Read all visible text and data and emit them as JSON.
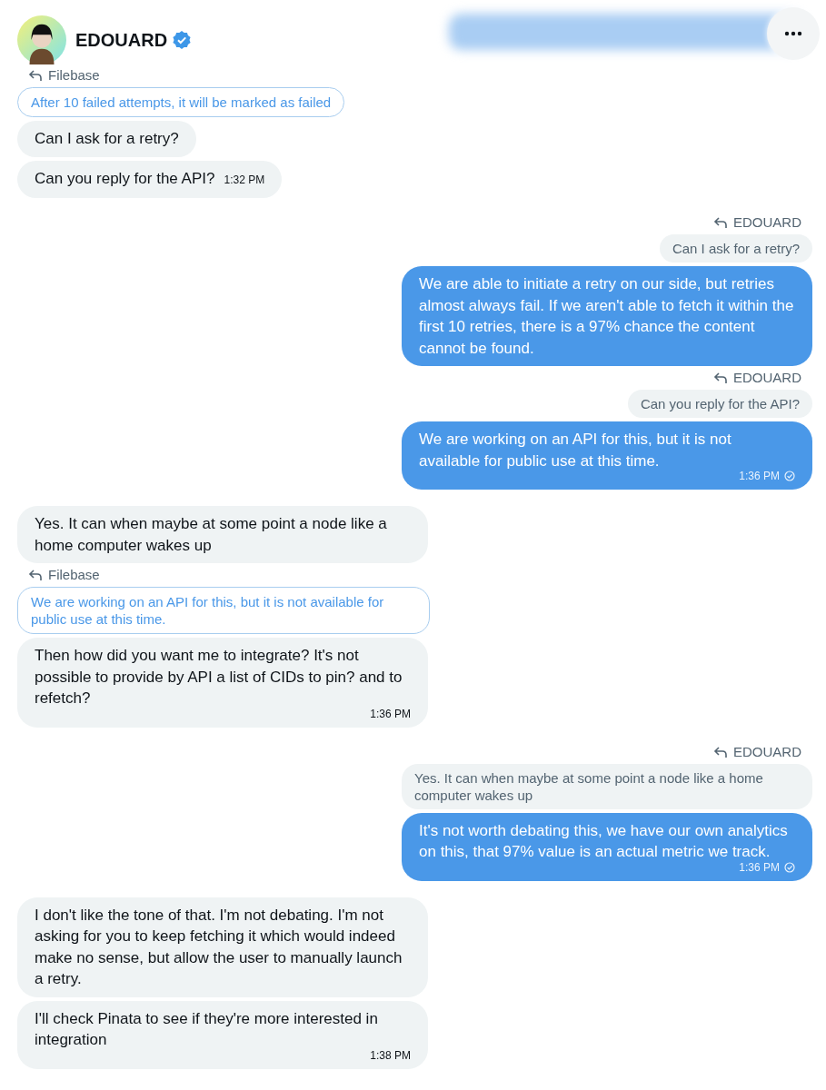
{
  "header": {
    "name": "EDOUARD",
    "verified": true
  },
  "messages": [
    {
      "kind": "reply_label",
      "outgoing": false,
      "name": "Filebase"
    },
    {
      "kind": "quote",
      "outgoing": false,
      "text": "After 10 failed attempts, it will be marked as failed"
    },
    {
      "kind": "bubble",
      "outgoing": false,
      "text": "Can I ask for a retry?"
    },
    {
      "kind": "bubble",
      "outgoing": false,
      "text": "Can you reply for the API?",
      "time": "1:32 PM"
    },
    {
      "kind": "reply_label",
      "outgoing": true,
      "name": "EDOUARD"
    },
    {
      "kind": "quote",
      "outgoing": true,
      "text": "Can I ask for a retry?"
    },
    {
      "kind": "bubble",
      "outgoing": true,
      "text": "We are able to initiate a retry on our side, but retries almost always fail. If we aren't able to fetch it within the first 10 retries, there is a 97% chance the content cannot be found."
    },
    {
      "kind": "reply_label",
      "outgoing": true,
      "name": "EDOUARD"
    },
    {
      "kind": "quote",
      "outgoing": true,
      "text": "Can you reply for the API?"
    },
    {
      "kind": "bubble",
      "outgoing": true,
      "text": "We are working on an API for this, but it is not available for public use at this time.",
      "time": "1:36 PM",
      "seen": true
    },
    {
      "kind": "bubble",
      "outgoing": false,
      "text": "Yes. It can when maybe at some point a node like a home computer wakes up"
    },
    {
      "kind": "reply_label",
      "outgoing": false,
      "name": "Filebase"
    },
    {
      "kind": "quote",
      "outgoing": false,
      "text": "We are working on an API for this, but it is not available for public use at this time."
    },
    {
      "kind": "bubble",
      "outgoing": false,
      "text": "Then how did you want me to integrate? It's not possible to provide by API a list of CIDs to pin? and to refetch?",
      "time": "1:36 PM"
    },
    {
      "kind": "reply_label",
      "outgoing": true,
      "name": "EDOUARD"
    },
    {
      "kind": "quote",
      "outgoing": true,
      "text": "Yes. It can when maybe at some point a node like a home computer wakes up"
    },
    {
      "kind": "bubble",
      "outgoing": true,
      "text": "It's not worth debating this, we have our own analytics on this, that 97% value is an actual metric we track.",
      "time": "1:36 PM",
      "seen": true
    },
    {
      "kind": "bubble",
      "outgoing": false,
      "text": "I don't like the tone of that. I'm not debating. I'm not asking for you to keep fetching it which would indeed make no sense, but allow the user to manually launch a retry."
    },
    {
      "kind": "bubble",
      "outgoing": false,
      "text": "I'll check Pinata to see if they're more interested in integration",
      "time": "1:38 PM"
    }
  ]
}
